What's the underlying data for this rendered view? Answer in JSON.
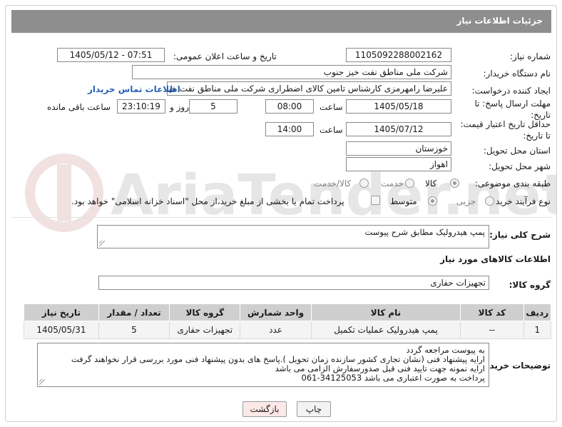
{
  "header": {
    "title": "جزئیات اطلاعات نیاز"
  },
  "watermark": {
    "text": "AriaTender.net"
  },
  "form": {
    "need_number_label": "شماره نیاز:",
    "need_number": "1105092288002162",
    "announce_label": "تاریخ و ساعت اعلان عمومی:",
    "announce_value": "1405/05/12 - 07:51",
    "buyer_org_label": "نام دستگاه خریدار:",
    "buyer_org": "شرکت ملی مناطق نفت خیز جنوب",
    "creator_label": "ایجاد کننده درخواست:",
    "creator": "علیرضا رامهرمزی کارشناس تامین کالای اضطراری شرکت ملی مناطق نفت خیز جنوب",
    "contact_link": "اطلاعات تماس خریدار",
    "deadline_label": "مهلت ارسال پاسخ: تا تاریخ:",
    "deadline_date": "1405/05/18",
    "time_label": "ساعت",
    "deadline_time": "08:00",
    "days_value": "5",
    "days_label": "روز و",
    "remaining_value": "23:10:19",
    "remaining_label": "ساعت باقی مانده",
    "validity_label": "حداقل تاریخ اعتبار قیمت: تا تاریخ:",
    "validity_date": "1405/07/12",
    "validity_time": "14:00",
    "province_label": "استان محل تحویل:",
    "province": "خوزستان",
    "city_label": "شهر محل تحویل:",
    "city": "اهواز",
    "category_label": "طبقه بندی موضوعی:",
    "category_options": [
      "کالا",
      "خدمت",
      "کالا/خدمت"
    ],
    "process_label": "نوع فرآیند خرید :",
    "process_options": [
      "جزیی",
      "متوسط"
    ],
    "payment_note": "پرداخت تمام یا بخشی از مبلغ خرید،از محل \"اسناد خزانه اسلامی\" خواهد بود."
  },
  "description": {
    "label": "شرح کلی نیاز:",
    "value": "پمپ هیدرولیک مطابق شرح پیوست"
  },
  "goods": {
    "section_title": "اطلاعات کالاهای مورد نیاز",
    "group_label": "گروه کالا:",
    "group_value": "تجهیزات حفاری",
    "columns": [
      "ردیف",
      "کد کالا",
      "نام کالا",
      "واحد شمارش",
      "گروه کالا",
      "تعداد / مقدار",
      "تاریخ نیاز"
    ],
    "rows": [
      [
        "1",
        "--",
        "پمپ هیدرولیک عملیات تکمیل",
        "عدد",
        "تجهیزات حفاری",
        "5",
        "1405/05/31"
      ]
    ]
  },
  "buyer_notes": {
    "label": "توضیحات خریدار:",
    "lines": [
      "به پیوست مراجعه گردد",
      "ارایه پیشنهاد فنی (نشان تجاری کشور سازنده زمان تحویل ).پاسخ های بدون پیشنهاد فنی مورد بررسی قرار نخواهند گرفت",
      "ارایه نمونه جهت تایید فنی قبل صدورسفارش الزامی می باشد",
      "پرداخت به صورت اعتباری می باشد 34125053-061"
    ]
  },
  "buttons": {
    "print": "چاپ",
    "back": "بازگشت"
  },
  "colors": {
    "header_bg": "#8e8e8e",
    "link": "#2a62b8",
    "back_btn_bg": "#fde8e8"
  }
}
